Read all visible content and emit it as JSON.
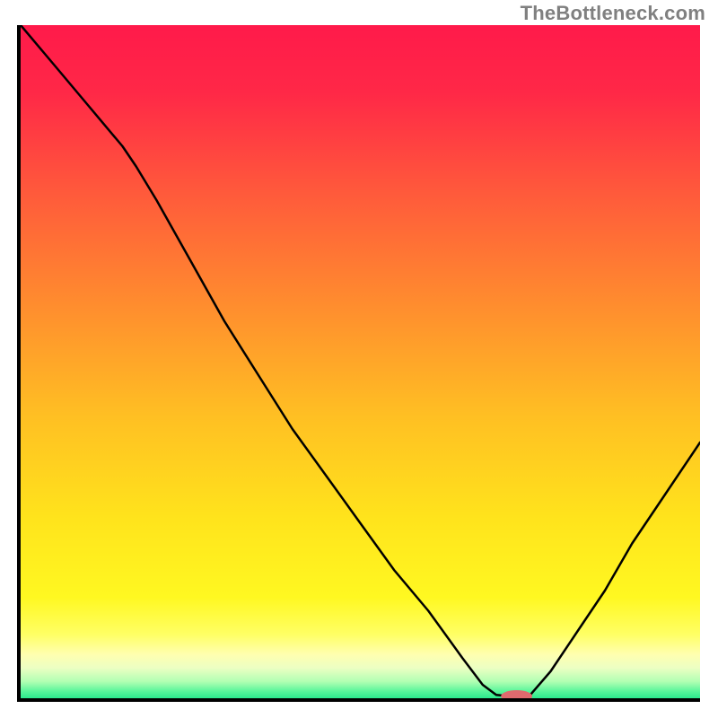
{
  "watermark": "TheBottleneck.com",
  "chart_data": {
    "type": "line",
    "title": "",
    "xlabel": "",
    "ylabel": "",
    "xlim": [
      0,
      100
    ],
    "ylim": [
      0,
      100
    ],
    "grid": false,
    "legend": false,
    "series": [
      {
        "name": "curve",
        "stroke": "#000000",
        "stroke_width": 2.5,
        "x": [
          0,
          5,
          10,
          15,
          17,
          20,
          25,
          30,
          35,
          40,
          45,
          50,
          55,
          60,
          65,
          68,
          70,
          72,
          74,
          75,
          78,
          82,
          86,
          90,
          94,
          100
        ],
        "y": [
          100,
          94,
          88,
          82,
          79,
          74,
          65,
          56,
          48,
          40,
          33,
          26,
          19,
          13,
          6,
          2,
          0.5,
          0.3,
          0.3,
          0.5,
          4,
          10,
          16,
          23,
          29,
          38
        ]
      }
    ],
    "marker": {
      "name": "target-marker",
      "fill": "#df6a6e",
      "cx": 73,
      "cy": 0.3,
      "rx": 2.3,
      "ry": 0.9
    },
    "gradient_stops": [
      {
        "offset": 0.0,
        "color": "#ff1a4a"
      },
      {
        "offset": 0.1,
        "color": "#ff2847"
      },
      {
        "offset": 0.25,
        "color": "#ff5a3b"
      },
      {
        "offset": 0.42,
        "color": "#ff8e2e"
      },
      {
        "offset": 0.58,
        "color": "#ffbf23"
      },
      {
        "offset": 0.73,
        "color": "#ffe31c"
      },
      {
        "offset": 0.85,
        "color": "#fff821"
      },
      {
        "offset": 0.905,
        "color": "#ffff64"
      },
      {
        "offset": 0.935,
        "color": "#ffffb0"
      },
      {
        "offset": 0.955,
        "color": "#ecffc3"
      },
      {
        "offset": 0.975,
        "color": "#b2ffb3"
      },
      {
        "offset": 0.99,
        "color": "#57f59a"
      },
      {
        "offset": 1.0,
        "color": "#2be98d"
      }
    ]
  }
}
